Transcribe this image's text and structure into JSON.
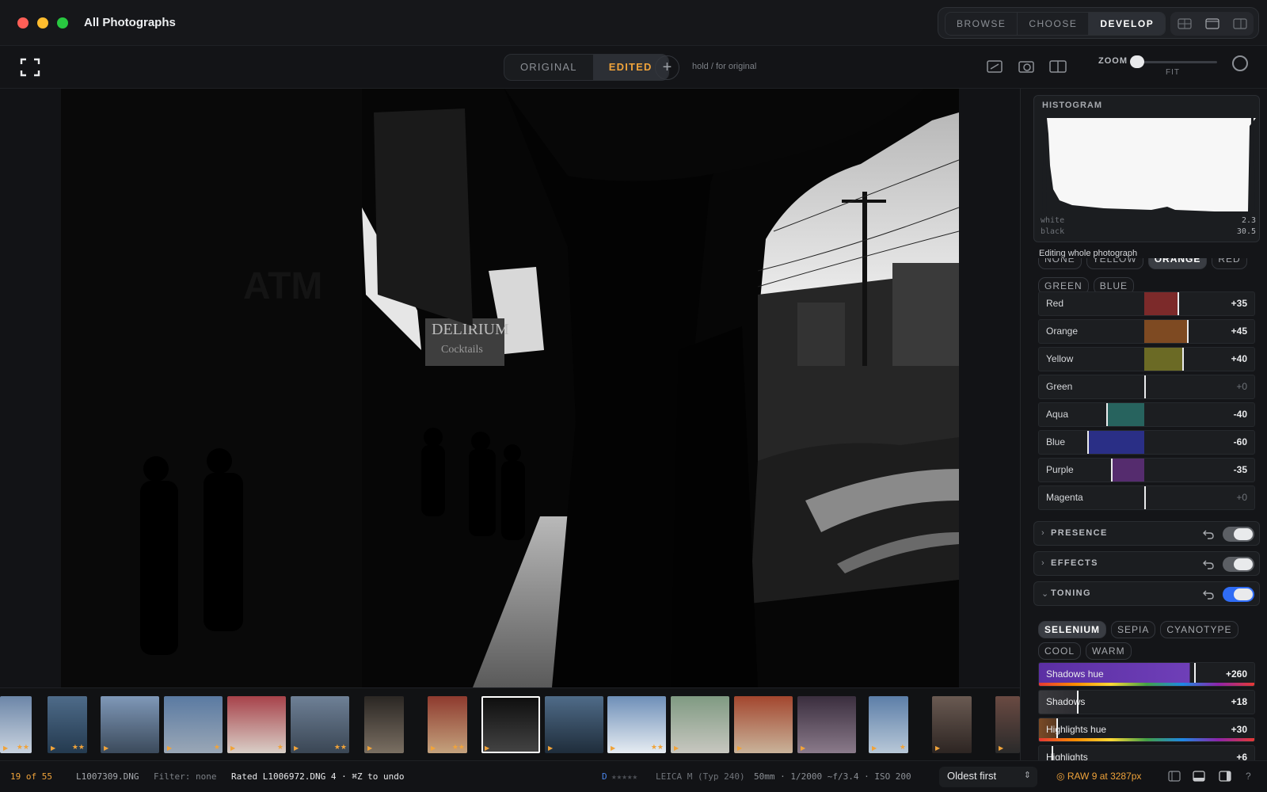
{
  "window": {
    "title": "All Photographs"
  },
  "modes": {
    "tabs": [
      "BROWSE",
      "CHOOSE",
      "DEVELOP"
    ],
    "active": "DEVELOP"
  },
  "toolbar": {
    "original_label": "ORIGINAL",
    "edited_label": "EDITED",
    "plus_label": "+",
    "hold_hint": "hold / for original",
    "zoom_label": "ZOOM",
    "zoom_value": "FIT"
  },
  "histogram": {
    "title": "HISTOGRAM",
    "white_label": "white",
    "white_value": "2.3",
    "black_label": "black",
    "black_value": "30.5",
    "editing_note": "Editing whole photograph"
  },
  "color_chips": {
    "row1": [
      "NONE",
      "YELLOW",
      "ORANGE",
      "RED"
    ],
    "row2": [
      "GREEN",
      "BLUE"
    ],
    "active": "ORANGE"
  },
  "color_sliders": [
    {
      "name": "Red",
      "value": "+35",
      "amount": 35,
      "color": "#7c2a2a"
    },
    {
      "name": "Orange",
      "value": "+45",
      "amount": 45,
      "color": "#7e4a22"
    },
    {
      "name": "Yellow",
      "value": "+40",
      "amount": 40,
      "color": "#6b6a25"
    },
    {
      "name": "Green",
      "value": "+0",
      "amount": 0,
      "color": "#2f6b33"
    },
    {
      "name": "Aqua",
      "value": "-40",
      "amount": -40,
      "color": "#27635e"
    },
    {
      "name": "Blue",
      "value": "-60",
      "amount": -60,
      "color": "#2a2f86"
    },
    {
      "name": "Purple",
      "value": "-35",
      "amount": -35,
      "color": "#552c6e"
    },
    {
      "name": "Magenta",
      "value": "+0",
      "amount": 0,
      "color": "#6b2a5c"
    }
  ],
  "sections": {
    "presence": "PRESENCE",
    "effects": "EFFECTS",
    "toning": "TONING"
  },
  "toning": {
    "chips_row1": [
      "SELENIUM",
      "SEPIA",
      "CYANOTYPE"
    ],
    "chips_row2": [
      "COOL",
      "WARM"
    ],
    "active": "SELENIUM",
    "sliders": [
      {
        "name": "Shadows hue",
        "value": "+260"
      },
      {
        "name": "Shadows",
        "value": "+18"
      },
      {
        "name": "Highlights hue",
        "value": "+30"
      },
      {
        "name": "Highlights",
        "value": "+6"
      }
    ]
  },
  "filmstrip": {
    "selected_index": 8,
    "thumbs": [
      {
        "stars": "★★"
      },
      {
        "stars": "★★"
      },
      {
        "stars": ""
      },
      {
        "stars": "★"
      },
      {
        "stars": "★"
      },
      {
        "stars": "★★"
      },
      {
        "stars": ""
      },
      {
        "stars": "★★"
      },
      {
        "stars": ""
      },
      {
        "stars": ""
      },
      {
        "stars": "★★"
      },
      {
        "stars": ""
      },
      {
        "stars": ""
      },
      {
        "stars": ""
      },
      {
        "stars": "★"
      },
      {
        "stars": ""
      },
      {
        "stars": ""
      }
    ]
  },
  "status": {
    "count": "19 of 55",
    "filename": "L1007309.DNG",
    "filter": "Filter: none",
    "rated_message": "Rated L1006972.DNG 4 · ⌘Z to undo",
    "dot_label": "D",
    "dot_stars": "★★★★★",
    "camera": "LEICA M (Typ 240)",
    "exposure": "50mm · 1/2000 ~f/3.4 · ISO 200",
    "sort": "Oldest first",
    "raw_info": "RAW 9 at 3287px",
    "help": "?"
  },
  "colors": {
    "accent": "#f0a33a",
    "toggle_on": "#2f6cf5",
    "panel_bg": "#141518"
  }
}
